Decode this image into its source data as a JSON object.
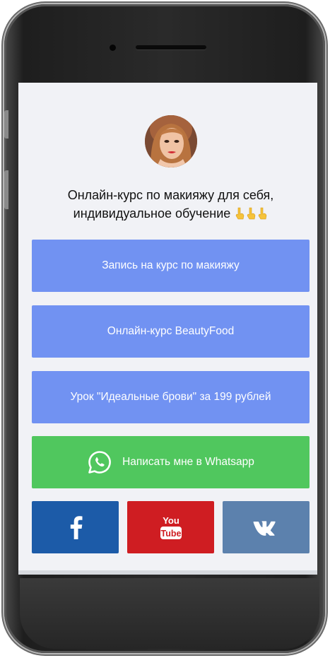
{
  "profile": {
    "headline": "Онлайн-курс по макияжу для себя, индивидуальное обучение"
  },
  "links": [
    {
      "label": "Запись на курс по макияжу",
      "color": "#7192f2"
    },
    {
      "label": "Онлайн-курс BeautyFood",
      "color": "#7192f2"
    },
    {
      "label": "Урок \"Идеальные брови\" за 199 рублей",
      "color": "#7192f2"
    },
    {
      "label": "Написать мне в Whatsapp",
      "color": "#50c75e",
      "icon": "whatsapp-icon"
    }
  ],
  "social": [
    {
      "icon": "facebook-icon",
      "color": "#1c5ba8"
    },
    {
      "icon": "youtube-icon",
      "color": "#cf1d22",
      "text_top": "You",
      "text_bottom": "Tube"
    },
    {
      "icon": "vk-icon",
      "color": "#5c81ad"
    }
  ],
  "emoji": [
    "👇",
    "👇",
    "👇"
  ]
}
